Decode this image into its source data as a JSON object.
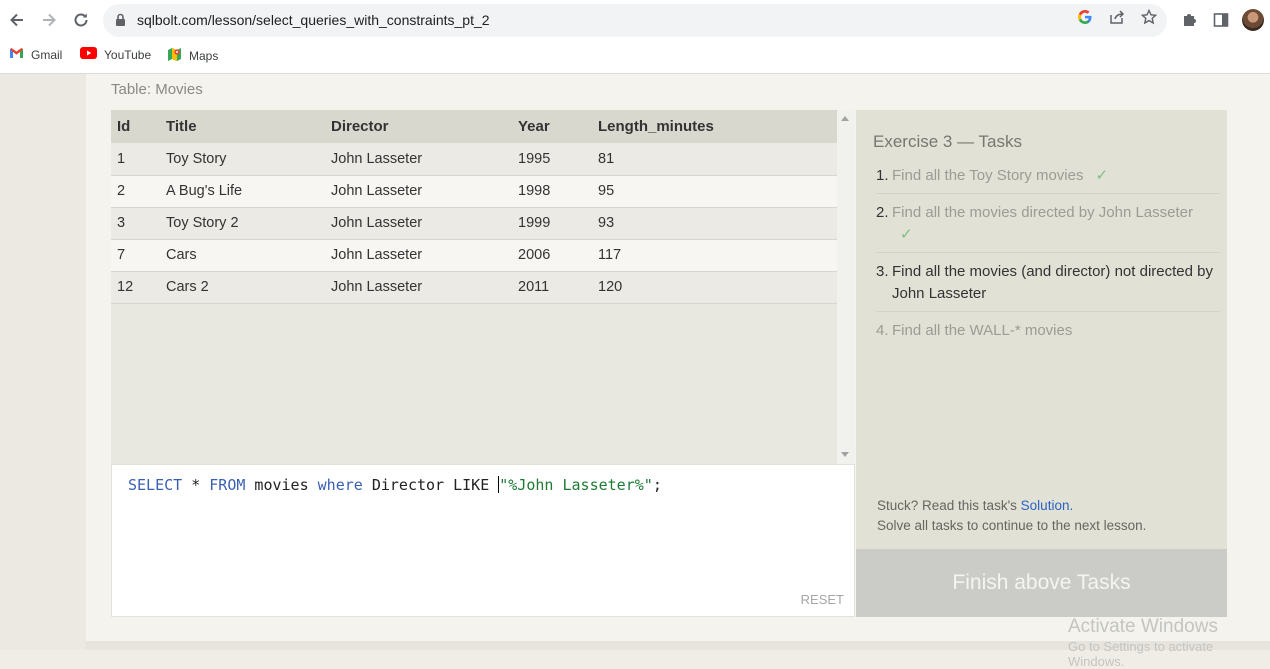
{
  "browser": {
    "url": "sqlbolt.com/lesson/select_queries_with_constraints_pt_2",
    "bookmarks": [
      {
        "label": "Gmail",
        "icon": "gmail-icon"
      },
      {
        "label": "YouTube",
        "icon": "youtube-icon"
      },
      {
        "label": "Maps",
        "icon": "maps-icon"
      }
    ]
  },
  "results": {
    "caption": "Table: Movies",
    "columns": [
      "Id",
      "Title",
      "Director",
      "Year",
      "Length_minutes"
    ],
    "rows": [
      [
        "1",
        "Toy Story",
        "John Lasseter",
        "1995",
        "81"
      ],
      [
        "2",
        "A Bug's Life",
        "John Lasseter",
        "1998",
        "95"
      ],
      [
        "3",
        "Toy Story 2",
        "John Lasseter",
        "1999",
        "93"
      ],
      [
        "7",
        "Cars",
        "John Lasseter",
        "2006",
        "117"
      ],
      [
        "12",
        "Cars 2",
        "John Lasseter",
        "2011",
        "120"
      ]
    ]
  },
  "editor": {
    "query_parts": [
      {
        "text": "SELECT",
        "kind": "keyword"
      },
      {
        "text": " * ",
        "kind": "plain"
      },
      {
        "text": "FROM",
        "kind": "keyword"
      },
      {
        "text": " movies ",
        "kind": "plain"
      },
      {
        "text": "where",
        "kind": "keyword"
      },
      {
        "text": " Director LIKE ",
        "kind": "plain"
      },
      {
        "text": "\"%John Lasseter%\"",
        "kind": "string"
      },
      {
        "text": ";",
        "kind": "plain"
      }
    ],
    "reset_label": "RESET"
  },
  "tasks": {
    "title": "Exercise 3 — Tasks",
    "items": [
      {
        "num": "1.",
        "text": "Find all the Toy Story movies",
        "status": "done",
        "check": "✓"
      },
      {
        "num": "2.",
        "text": "Find all the movies directed by John Lasseter",
        "status": "done",
        "check": "✓"
      },
      {
        "num": "3.",
        "text": "Find all the movies (and director) not directed by John Lasseter",
        "status": "current",
        "check": ""
      },
      {
        "num": "4.",
        "text": "Find all the WALL-* movies",
        "status": "pending",
        "check": ""
      }
    ],
    "stuck_prefix": "Stuck? Read this task's",
    "solution_link": "Solution.",
    "solve_all_text": "Solve all tasks to continue to the next lesson.",
    "finish_label": "Finish above Tasks"
  },
  "watermark": {
    "line1": "Activate Windows",
    "line2": "Go to Settings to activate Windows."
  }
}
